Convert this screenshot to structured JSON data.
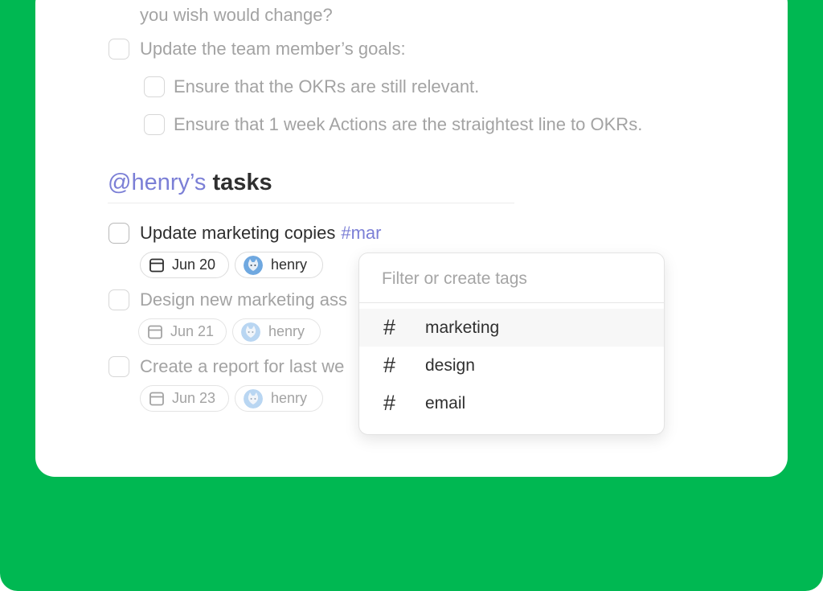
{
  "checklist": {
    "partial_line": "you wish would change?",
    "item_goals": "Update the team member’s goals:",
    "sub_okrs": "Ensure that the OKRs are still relevant.",
    "sub_actions": "Ensure that 1 week Actions are the straightest line to OKRs."
  },
  "section": {
    "mention": "@henry’s",
    "title": "tasks"
  },
  "tasks": [
    {
      "title": "Update marketing copies",
      "tag_input": "#mar",
      "date": "Jun 20",
      "assignee": "henry"
    },
    {
      "title": "Design new marketing ass",
      "date": "Jun 21",
      "assignee": "henry"
    },
    {
      "title": "Create a report for last we",
      "date": "Jun 23",
      "assignee": "henry"
    }
  ],
  "tag_dropdown": {
    "placeholder": "Filter or create tags",
    "options": [
      {
        "label": "marketing",
        "icon": "hash-icon"
      },
      {
        "label": "design",
        "icon": "hash-icon"
      },
      {
        "label": "email",
        "icon": "hash-icon"
      }
    ]
  },
  "colors": {
    "background": "#00b852",
    "accent": "#7b7fd6",
    "muted_text": "#a3a3a3",
    "dark_text": "#2e2e2e"
  }
}
